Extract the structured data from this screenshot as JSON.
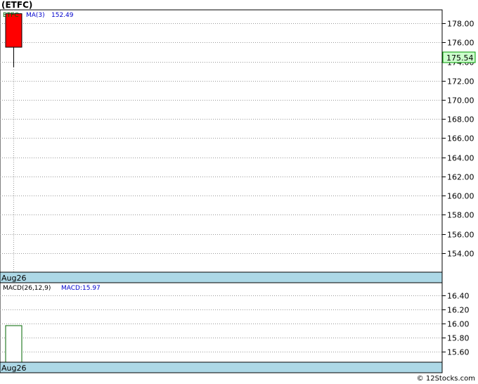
{
  "title": "(ETFC)",
  "symbol": "ETFC",
  "footer": "© 12Stocks.com",
  "colors": {
    "down_candle": "#ff0000",
    "current_price_box": "#ccffcc",
    "date_bar": "#add8e6",
    "ma_text": "#0000cc",
    "symbol_text": "#006600"
  },
  "chart_data": [
    {
      "type": "candlestick",
      "name": "price",
      "legend": {
        "symbol": "ETFC",
        "ma_label": "MA(3)",
        "ma_value": "152.49"
      },
      "x": [
        "Aug26"
      ],
      "candles": [
        {
          "date": "Aug26",
          "open": 179.0,
          "high": 179.0,
          "low": 173.4,
          "close": 175.5,
          "direction": "down"
        }
      ],
      "current_price": "175.54",
      "ylim": [
        152.0,
        179.4
      ],
      "yticks": [
        "178.00",
        "176.00",
        "174.00",
        "172.00",
        "170.00",
        "168.00",
        "166.00",
        "164.00",
        "162.00",
        "160.00",
        "158.00",
        "156.00",
        "154.00"
      ],
      "grid": true
    },
    {
      "type": "bar",
      "name": "macd",
      "legend": {
        "label": "MACD(26,12,9)",
        "value_label": "MACD:15.97"
      },
      "x": [
        "Aug26"
      ],
      "values": [
        15.97
      ],
      "ylim": [
        15.45,
        16.58
      ],
      "yticks": [
        "16.40",
        "16.20",
        "16.00",
        "15.80",
        "15.60"
      ],
      "grid": true
    }
  ]
}
